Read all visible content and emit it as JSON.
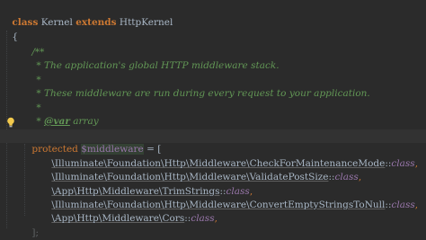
{
  "code": {
    "line1": {
      "kw_class": "class",
      "name": "Kernel",
      "kw_extends": "extends",
      "parent": "HttpKernel"
    },
    "line2": {
      "brace": "{"
    },
    "doc": {
      "open": "/**",
      "summary": "* The application's global HTTP middleware stack.",
      "blank1": "*",
      "detail": "* These middleware are run during every request to your application.",
      "blank2": "*",
      "star": "*",
      "var_tag": "@var",
      "var_type": "array",
      "close": "*/"
    },
    "decl": {
      "modifier": "protected",
      "variable": "$middleware",
      "assign": " = ["
    },
    "middleware": [
      {
        "ns": "\\Illuminate\\Foundation\\Http\\Middleware\\CheckForMaintenanceMode",
        "suffix": "::",
        "cls": "class",
        "comma": ","
      },
      {
        "ns": "\\Illuminate\\Foundation\\Http\\Middleware\\ValidatePostSize",
        "suffix": "::",
        "cls": "class",
        "comma": ","
      },
      {
        "ns": "\\App\\Http\\Middleware\\TrimStrings",
        "suffix": "::",
        "cls": "class",
        "comma": ","
      },
      {
        "ns": "\\Illuminate\\Foundation\\Http\\Middleware\\ConvertEmptyStringsToNull",
        "suffix": "::",
        "cls": "class",
        "comma": ","
      },
      {
        "ns": "\\App\\Http\\Middleware\\Cors",
        "suffix": "::",
        "cls": "class",
        "comma": ","
      }
    ],
    "close_bracket": "];"
  },
  "icons": {
    "intention": "lightbulb-icon"
  },
  "colors": {
    "background": "#2b2b2b",
    "keyword": "#cc7832",
    "comment": "#629755",
    "field": "#9876aa",
    "text": "#a9b7c6"
  }
}
